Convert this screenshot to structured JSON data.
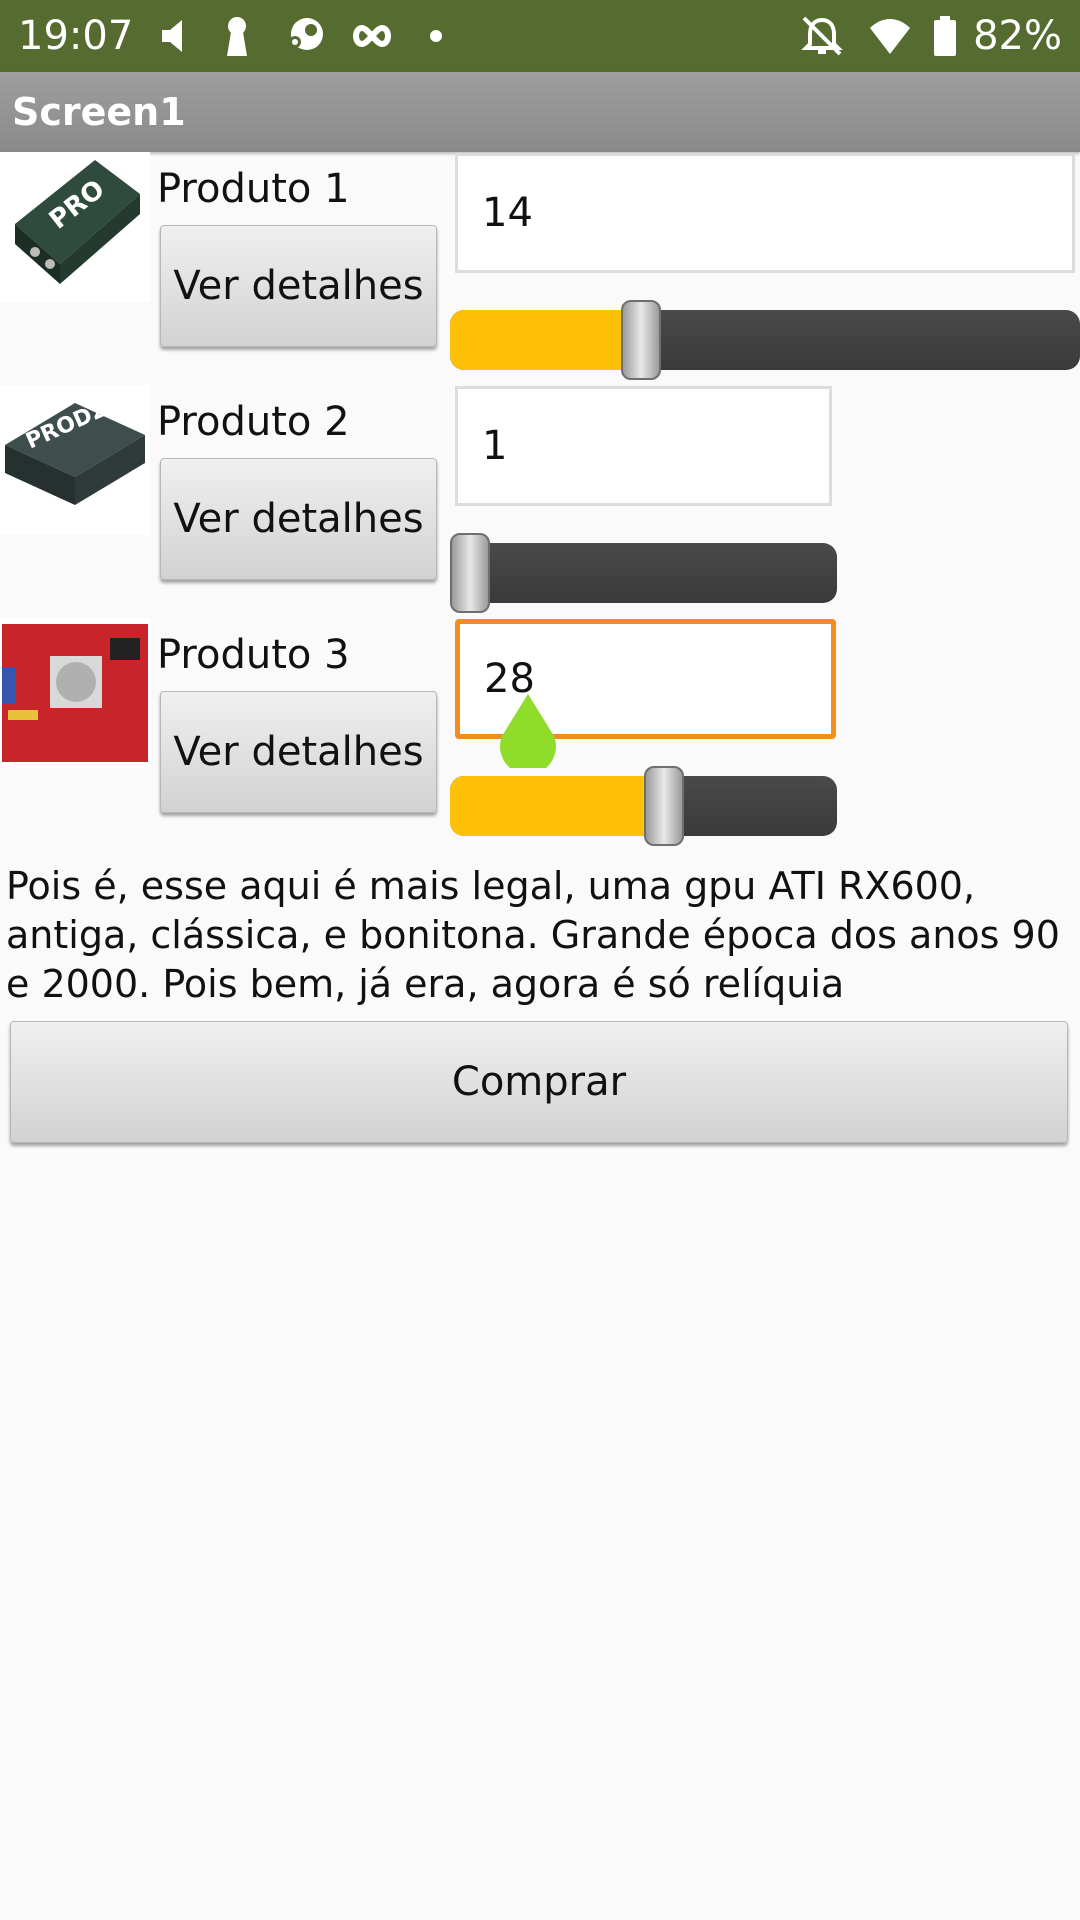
{
  "status_bar": {
    "time": "19:07",
    "battery": "82%",
    "icons": [
      "volume-icon",
      "keyhole-icon",
      "steam-icon",
      "infinity-icon",
      "dot-icon",
      "notifications-off-icon",
      "wifi-icon",
      "battery-icon"
    ]
  },
  "app": {
    "title": "Screen1"
  },
  "products": [
    {
      "label": "Produto 1",
      "button": "Ver detalhes",
      "quantity": "14",
      "slider_fraction": 0.29
    },
    {
      "label": "Produto 2",
      "button": "Ver detalhes",
      "quantity": "1",
      "slider_fraction": 0.0
    },
    {
      "label": "Produto 3",
      "button": "Ver detalhes",
      "quantity": "28",
      "slider_fraction": 0.56
    }
  ],
  "description": "Pois é, esse aqui é mais legal, uma gpu ATI RX600, antiga, clássica, e bonitona. Grande época dos anos 90 e 2000. Pois bem, já era, agora é só relíquia",
  "buy_button": "Comprar",
  "colors": {
    "status_bar": "#556b2f",
    "title_bar": "#9e9e9e",
    "slider_fill": "#ffc107",
    "slider_track": "#3f3f3f",
    "focus_border": "#f48d1e",
    "cursor": "#8fdc2a"
  }
}
